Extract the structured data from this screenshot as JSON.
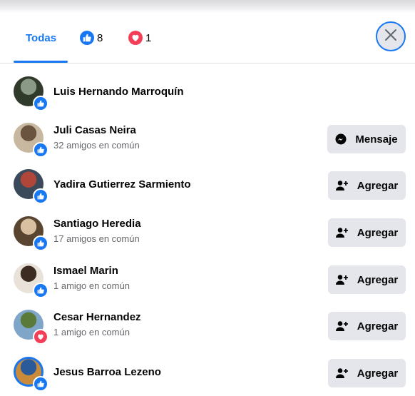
{
  "tabs": {
    "all_label": "Todas",
    "like_count": "8",
    "love_count": "1"
  },
  "people": [
    {
      "name": "Luis Hernando Marroquín",
      "mutual": "",
      "reaction": "like",
      "action": "",
      "avatar_colors": [
        "#2f3a2a",
        "#8a9a86"
      ]
    },
    {
      "name": "Juli Casas Neira",
      "mutual": "32 amigos en común",
      "reaction": "like",
      "action": "Mensaje",
      "action_icon": "messenger-icon",
      "avatar_colors": [
        "#c9b8a0",
        "#6a5440"
      ]
    },
    {
      "name": "Yadira Gutierrez Sarmiento",
      "mutual": "",
      "reaction": "like",
      "action": "Agregar",
      "action_icon": "add-friend-icon",
      "avatar_colors": [
        "#3a4a5a",
        "#b0463a"
      ]
    },
    {
      "name": "Santiago Heredia",
      "mutual": "17 amigos en común",
      "reaction": "like",
      "action": "Agregar",
      "action_icon": "add-friend-icon",
      "avatar_colors": [
        "#5a4630",
        "#d8c0a0"
      ]
    },
    {
      "name": "Ismael Marin",
      "mutual": "1 amigo en común",
      "reaction": "like",
      "action": "Agregar",
      "action_icon": "add-friend-icon",
      "avatar_colors": [
        "#e8e2d8",
        "#3c2c22"
      ]
    },
    {
      "name": "Cesar Hernandez",
      "mutual": "1 amigo en común",
      "reaction": "love",
      "action": "Agregar",
      "action_icon": "add-friend-icon",
      "avatar_colors": [
        "#7fa6c8",
        "#5a7a3a"
      ]
    },
    {
      "name": "Jesus Barroa Lezeno",
      "mutual": "",
      "reaction": "like",
      "action": "Agregar",
      "action_icon": "add-friend-icon",
      "avatar_colors": [
        "#c98a3a",
        "#2a5a9a"
      ]
    }
  ],
  "colors": {
    "accent": "#1877f2",
    "love": "#f33e58",
    "button_bg": "#e4e6eb",
    "secondary_text": "#65676b"
  }
}
